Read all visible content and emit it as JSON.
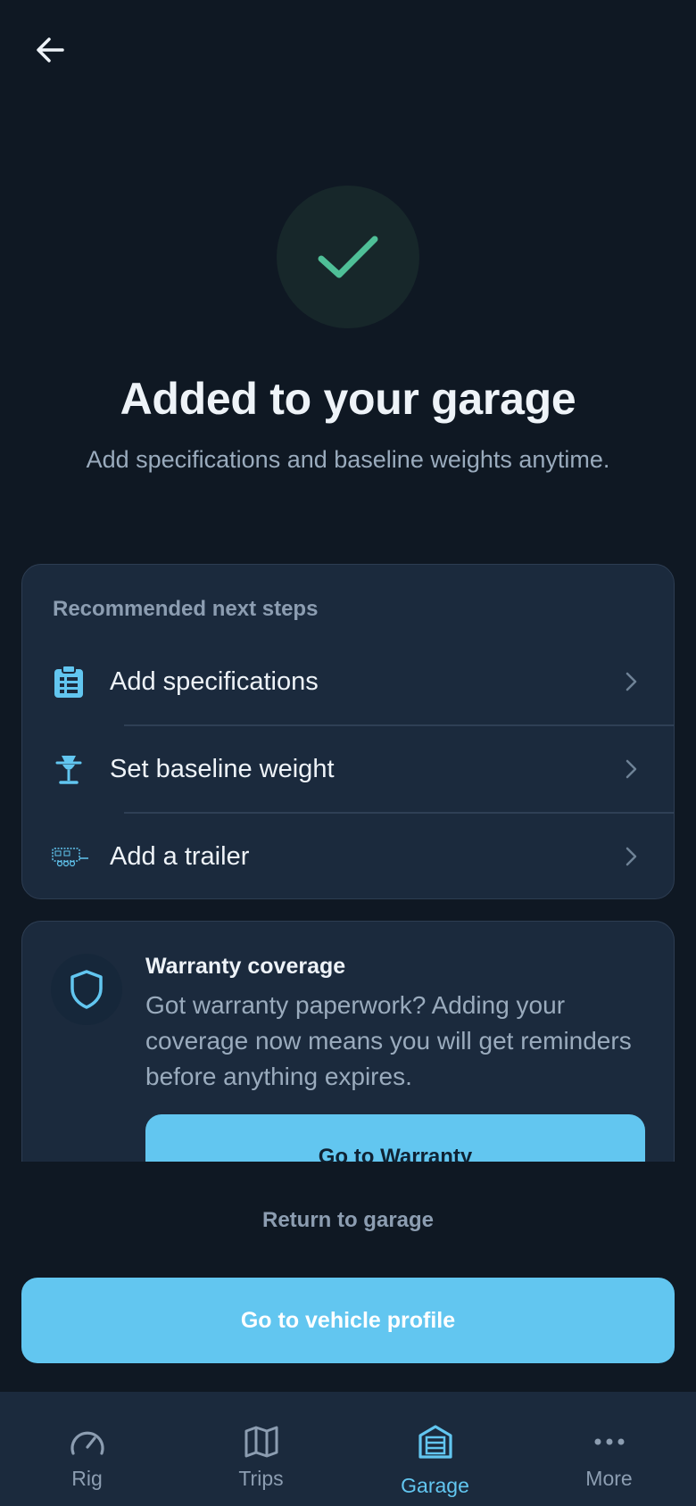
{
  "header": {
    "back_icon": "arrow-left-icon"
  },
  "hero": {
    "icon": "check-icon",
    "title": "Added to your garage",
    "subtitle": "Add specifications and baseline weights anytime."
  },
  "next_steps": {
    "heading": "Recommended next steps",
    "items": [
      {
        "label": "Add specifications",
        "icon": "clipboard-icon"
      },
      {
        "label": "Set baseline weight",
        "icon": "scale-icon"
      },
      {
        "label": "Add a trailer",
        "icon": "trailer-icon"
      }
    ]
  },
  "warranty": {
    "icon": "shield-icon",
    "title": "Warranty coverage",
    "body": "Got warranty paperwork? Adding your coverage now means you will get reminders before anything expires.",
    "button_label": "Go to Warranty"
  },
  "actions": {
    "return_label": "Return to garage",
    "primary_label": "Go to vehicle profile"
  },
  "tabbar": {
    "tabs": [
      {
        "label": "Rig",
        "icon": "gauge-icon",
        "active": false
      },
      {
        "label": "Trips",
        "icon": "map-icon",
        "active": false
      },
      {
        "label": "Garage",
        "icon": "garage-icon",
        "active": true
      },
      {
        "label": "More",
        "icon": "more-dots-icon",
        "active": false
      }
    ]
  },
  "colors": {
    "background": "#0f1823",
    "card": "#1b2a3d",
    "accent": "#62c6f0",
    "success": "#4fbf97"
  }
}
